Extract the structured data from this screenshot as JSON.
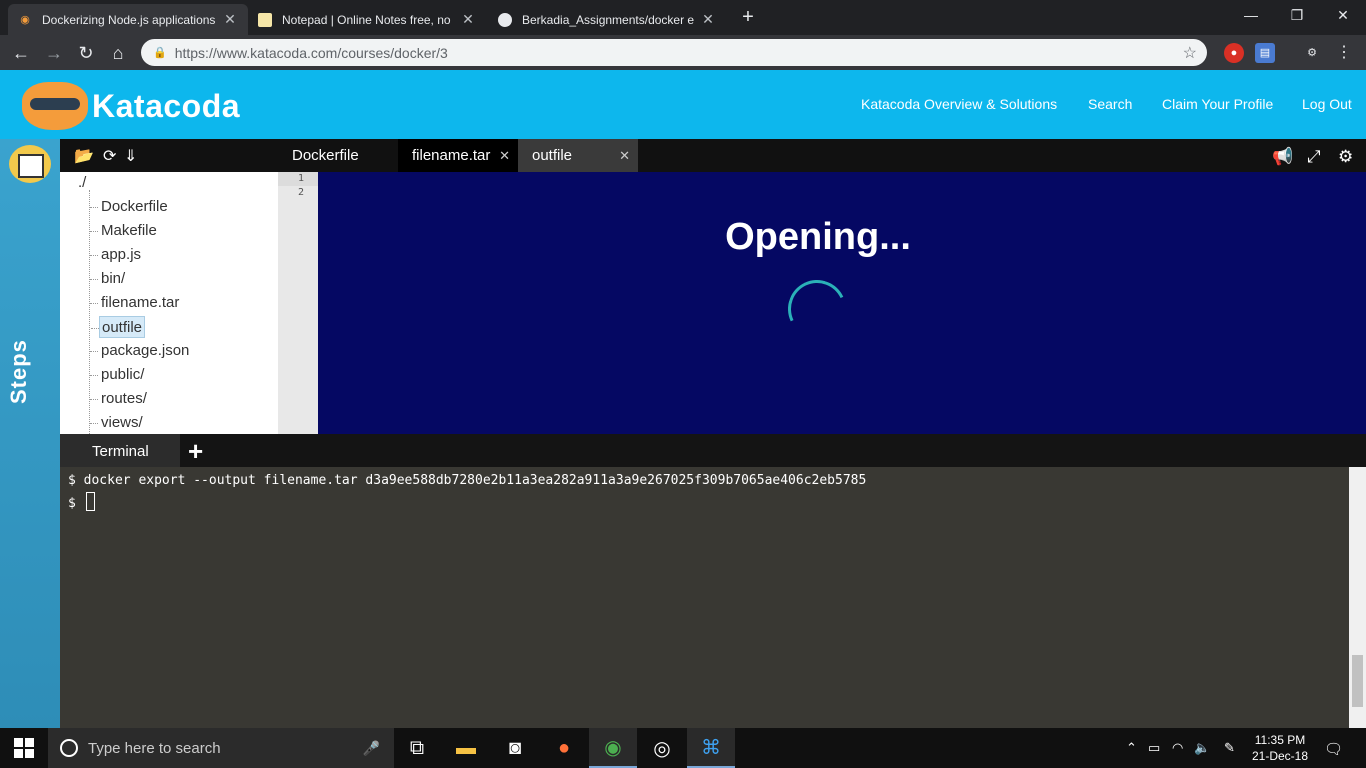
{
  "browser": {
    "tabs": [
      {
        "title": "Dockerizing Node.js applications",
        "icon": "katacoda-icon",
        "active": true
      },
      {
        "title": "Notepad | Online Notes free, no",
        "icon": "notepad-icon",
        "active": false
      },
      {
        "title": "Berkadia_Assignments/docker ex",
        "icon": "github-icon",
        "active": false
      }
    ],
    "close_glyph": "✕",
    "new_tab_glyph": "+",
    "window_controls": {
      "minimize": "—",
      "maximize": "❐",
      "close": "✕"
    },
    "url": "https://www.katacoda.com/courses/docker/3"
  },
  "header": {
    "logo_text": "Katacoda",
    "nav": [
      "Katacoda Overview & Solutions",
      "Search",
      "Claim Your Profile",
      "Log Out"
    ]
  },
  "steps": {
    "label": "Steps"
  },
  "editor": {
    "tabs": [
      {
        "label": "Dockerfile",
        "active": false,
        "closable": false
      },
      {
        "label": "filename.tar",
        "active": true,
        "closable": true
      },
      {
        "label": "outfile",
        "active": false,
        "closable": true
      }
    ],
    "tree_root": "./",
    "files": [
      "Dockerfile",
      "Makefile",
      "app.js",
      "bin/",
      "filename.tar",
      "outfile",
      "package.json",
      "public/",
      "routes/",
      "views/"
    ],
    "selected_file": "outfile",
    "line_numbers": [
      "1",
      "2"
    ],
    "preview_status": "Opening..."
  },
  "terminal": {
    "tab_label": "Terminal",
    "add_glyph": "+",
    "lines": [
      "$ docker export --output filename.tar d3a9ee588db7280e2b11a3ea282a911a3a9e267025f309b7065ae406c2eb5785",
      "$ "
    ]
  },
  "taskbar": {
    "search_placeholder": "Type here to search",
    "time": "11:35 PM",
    "date": "21-Dec-18"
  }
}
